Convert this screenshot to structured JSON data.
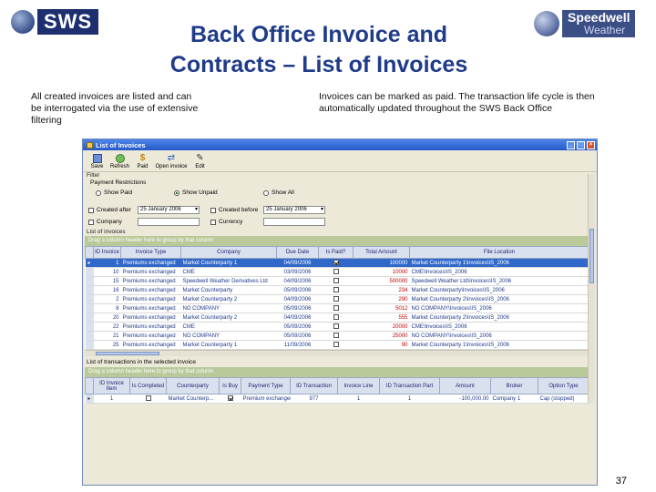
{
  "slide": {
    "title_line1": "Back Office Invoice and",
    "title_line2": "Contracts – List of Invoices",
    "caption_left": "All created invoices are listed and can be interrogated via the use of extensive filtering",
    "caption_right": "Invoices can be marked as paid. The transaction life cycle is then automatically updated throughout the SWS Back Office",
    "page_number": "37"
  },
  "logos": {
    "left_text": "SWS",
    "right_line1": "Speedwell",
    "right_line2": "Weather"
  },
  "window": {
    "title": "List of Invoices",
    "controls": [
      "_",
      "□",
      "×"
    ]
  },
  "toolbar": {
    "items": [
      {
        "label": "Save",
        "icon": "save-icon"
      },
      {
        "label": "Refresh",
        "icon": "refresh-icon"
      },
      {
        "label": "Paid",
        "icon": "paid-icon"
      },
      {
        "label": "Open invoice",
        "icon": "open-invoice-icon"
      },
      {
        "label": "Edit",
        "icon": "edit-icon"
      }
    ]
  },
  "filter": {
    "section_label": "Filter",
    "payment_label": "Payment Restrictions",
    "radios": [
      {
        "label": "Show Paid",
        "checked": false
      },
      {
        "label": "Show Unpaid",
        "checked": true
      },
      {
        "label": "Show All",
        "checked": false
      }
    ],
    "created_after_label": "Created after",
    "created_after_value": "25 January 2006",
    "created_before_label": "Created before",
    "created_before_value": "25 January 2006",
    "company_label": "Company",
    "currency_label": "Currency"
  },
  "invoices": {
    "section_label": "List of invoices",
    "group_hint": "Drag a column header here to group by that column",
    "headers": [
      "ID Invoice",
      "Invoice Type",
      "Company",
      "Due Date",
      "Is Paid?",
      "Total Amount",
      "File Location"
    ],
    "rows": [
      {
        "id": "1",
        "type": "Premiums exchanged",
        "company": "Market Counterparty 1",
        "due": "04/09/2006",
        "paid": true,
        "amount": "100000",
        "file": "Market Counterparty 1\\Invoices\\IS_2006"
      },
      {
        "id": "10",
        "type": "Premiums exchanged",
        "company": "CME",
        "due": "03/09/2006",
        "paid": false,
        "amount": "10000",
        "file": "CME\\Invoices\\IS_2006"
      },
      {
        "id": "15",
        "type": "Premiums exchanged",
        "company": "Speedwell Weather Derivatives Ltd",
        "due": "04/09/2006",
        "paid": false,
        "amount": "500000",
        "file": "Speedwell Weather Ltd\\Invoices\\IS_2006"
      },
      {
        "id": "16",
        "type": "Premiums exchanged",
        "company": "Market Counterparty",
        "due": "05/09/2006",
        "paid": false,
        "amount": "234",
        "file": "Market Counterparty\\Invoices\\IS_2006"
      },
      {
        "id": "2",
        "type": "Premiums exchanged",
        "company": "Market Counterparty 2",
        "due": "04/09/2006",
        "paid": false,
        "amount": "290",
        "file": "Market Counterparty 2\\Invoices\\IS_2006"
      },
      {
        "id": "8",
        "type": "Premiums exchanged",
        "company": "NO COMPANY",
        "due": "05/09/2006",
        "paid": false,
        "amount": "5012",
        "file": "NO COMPANY\\Invoices\\IS_2006"
      },
      {
        "id": "20",
        "type": "Premiums exchanged",
        "company": "Market Counterparty 2",
        "due": "04/09/2006",
        "paid": false,
        "amount": "555",
        "file": "Market Counterparty 2\\Invoices\\IS_2006"
      },
      {
        "id": "22",
        "type": "Premiums exchanged",
        "company": "CME",
        "due": "05/09/2006",
        "paid": false,
        "amount": "20000",
        "file": "CME\\Invoices\\IS_2006"
      },
      {
        "id": "21",
        "type": "Premiums exchanged",
        "company": "NO COMPANY",
        "due": "05/09/2006",
        "paid": false,
        "amount": "25000",
        "file": "NO COMPANY\\Invoices\\IS_2006"
      },
      {
        "id": "25",
        "type": "Premiums exchanged",
        "company": "Market Counterparty 1",
        "due": "11/09/2006",
        "paid": false,
        "amount": "90",
        "file": "Market Counterparty 1\\Invoices\\IS_2006"
      }
    ]
  },
  "transactions": {
    "section_label": "List of transactions in the selected invoice",
    "group_hint": "Drag a column header here to group by that column",
    "headers": [
      "ID Invoice Item",
      "Is Completed",
      "Counterparty",
      "Is Buy",
      "Payment Type",
      "ID Transaction",
      "Invoice Line",
      "ID Transaction Part",
      "Amount",
      "Broker",
      "Option Type"
    ],
    "rows": [
      {
        "id_item": "1",
        "completed": false,
        "counterparty": "Market Counterp...",
        "buy": true,
        "payment": "Premium exchanged",
        "id_tx": "977",
        "line": "1",
        "part": "1",
        "amount": "-100,000.00",
        "broker": "Company 1",
        "option": "Cap (stopped)"
      }
    ]
  },
  "colors": {
    "title": "#1f3b8a",
    "selected_row": "#3068c9",
    "amount": "#c00000",
    "group_hint_bar": "#b9c99a"
  }
}
